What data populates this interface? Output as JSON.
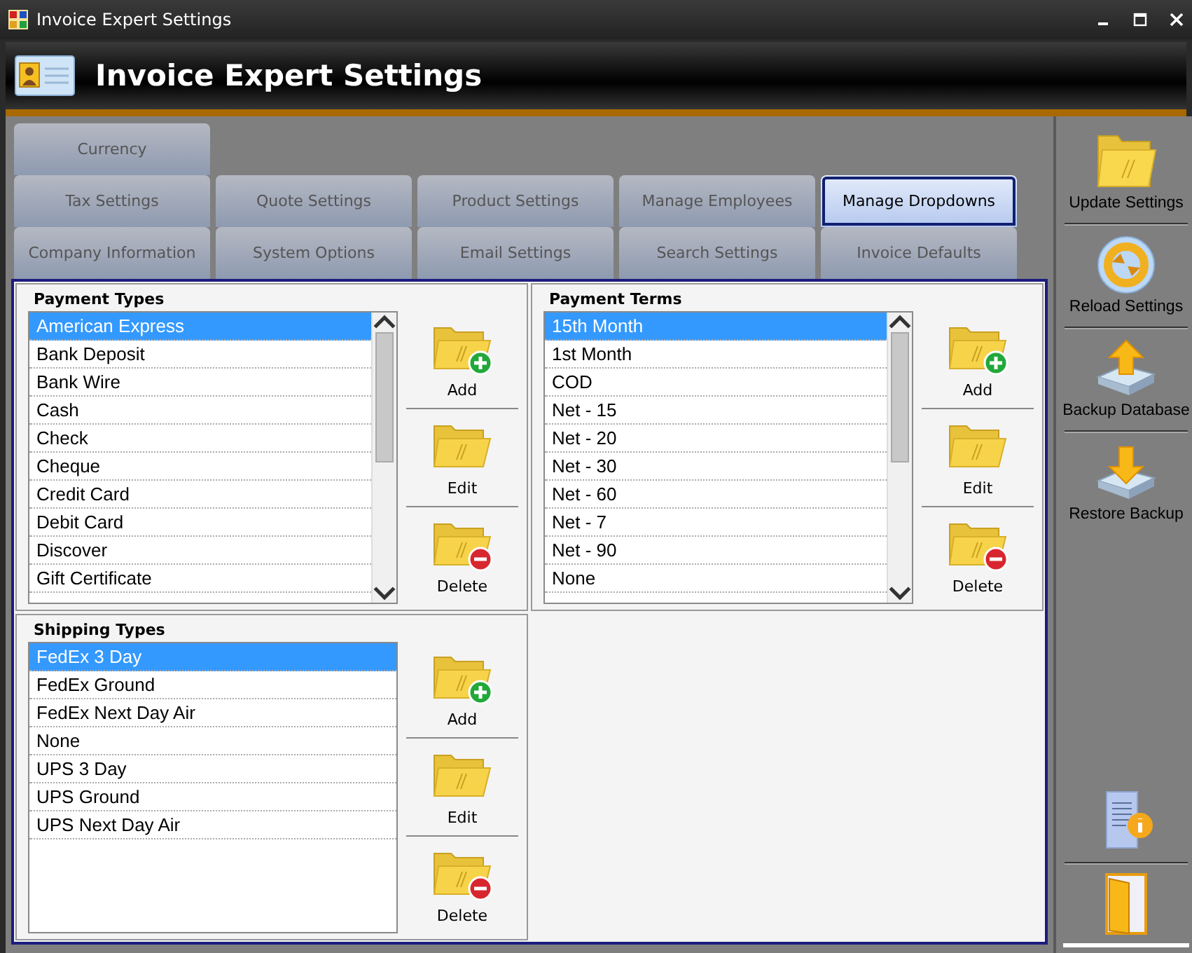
{
  "window": {
    "title": "Invoice Expert Settings",
    "header": "Invoice Expert Settings"
  },
  "tab_rows": [
    [
      {
        "label": "Currency",
        "selected": false
      }
    ],
    [
      {
        "label": "Tax Settings",
        "selected": false
      },
      {
        "label": "Quote Settings",
        "selected": false
      },
      {
        "label": "Product Settings",
        "selected": false
      },
      {
        "label": "Manage Employees",
        "selected": false
      },
      {
        "label": "Manage Dropdowns",
        "selected": true
      }
    ],
    [
      {
        "label": "Company Information",
        "selected": false
      },
      {
        "label": "System Options",
        "selected": false
      },
      {
        "label": "Email Settings",
        "selected": false
      },
      {
        "label": "Search Settings",
        "selected": false
      },
      {
        "label": "Invoice Defaults",
        "selected": false
      }
    ]
  ],
  "groups": [
    {
      "title": "Payment Types",
      "scrollable": true,
      "items": [
        {
          "label": "American Express",
          "selected": true
        },
        {
          "label": "Bank Deposit",
          "selected": false
        },
        {
          "label": "Bank Wire",
          "selected": false
        },
        {
          "label": "Cash",
          "selected": false
        },
        {
          "label": "Check",
          "selected": false
        },
        {
          "label": "Cheque",
          "selected": false
        },
        {
          "label": "Credit Card",
          "selected": false
        },
        {
          "label": "Debit Card",
          "selected": false
        },
        {
          "label": "Discover",
          "selected": false
        },
        {
          "label": "Gift Certificate",
          "selected": false
        }
      ],
      "buttons": [
        {
          "kind": "add",
          "label": "Add"
        },
        {
          "kind": "edit",
          "label": "Edit"
        },
        {
          "kind": "delete",
          "label": "Delete"
        }
      ]
    },
    {
      "title": "Payment Terms",
      "scrollable": true,
      "items": [
        {
          "label": "15th Month",
          "selected": true
        },
        {
          "label": "1st Month",
          "selected": false
        },
        {
          "label": "COD",
          "selected": false
        },
        {
          "label": "Net - 15",
          "selected": false
        },
        {
          "label": "Net - 20",
          "selected": false
        },
        {
          "label": "Net - 30",
          "selected": false
        },
        {
          "label": "Net - 60",
          "selected": false
        },
        {
          "label": "Net - 7",
          "selected": false
        },
        {
          "label": "Net - 90",
          "selected": false
        },
        {
          "label": "None",
          "selected": false
        }
      ],
      "buttons": [
        {
          "kind": "add",
          "label": "Add"
        },
        {
          "kind": "edit",
          "label": "Edit"
        },
        {
          "kind": "delete",
          "label": "Delete"
        }
      ]
    },
    {
      "title": "Shipping Types",
      "scrollable": false,
      "items": [
        {
          "label": "FedEx 3 Day",
          "selected": true
        },
        {
          "label": "FedEx Ground",
          "selected": false
        },
        {
          "label": "FedEx Next Day Air",
          "selected": false
        },
        {
          "label": "None",
          "selected": false
        },
        {
          "label": "UPS 3 Day",
          "selected": false
        },
        {
          "label": "UPS Ground",
          "selected": false
        },
        {
          "label": "UPS Next Day Air",
          "selected": false
        }
      ],
      "buttons": [
        {
          "kind": "add",
          "label": "Add"
        },
        {
          "kind": "edit",
          "label": "Edit"
        },
        {
          "kind": "delete",
          "label": "Delete"
        }
      ]
    }
  ],
  "sidebar": {
    "actions": [
      {
        "kind": "update",
        "label": "Update Settings"
      },
      {
        "kind": "reload",
        "label": "Reload Settings"
      },
      {
        "kind": "backup",
        "label": "Backup Database"
      },
      {
        "kind": "restore",
        "label": "Restore Backup"
      }
    ],
    "bottom": [
      {
        "kind": "info"
      },
      {
        "kind": "exit"
      }
    ]
  }
}
